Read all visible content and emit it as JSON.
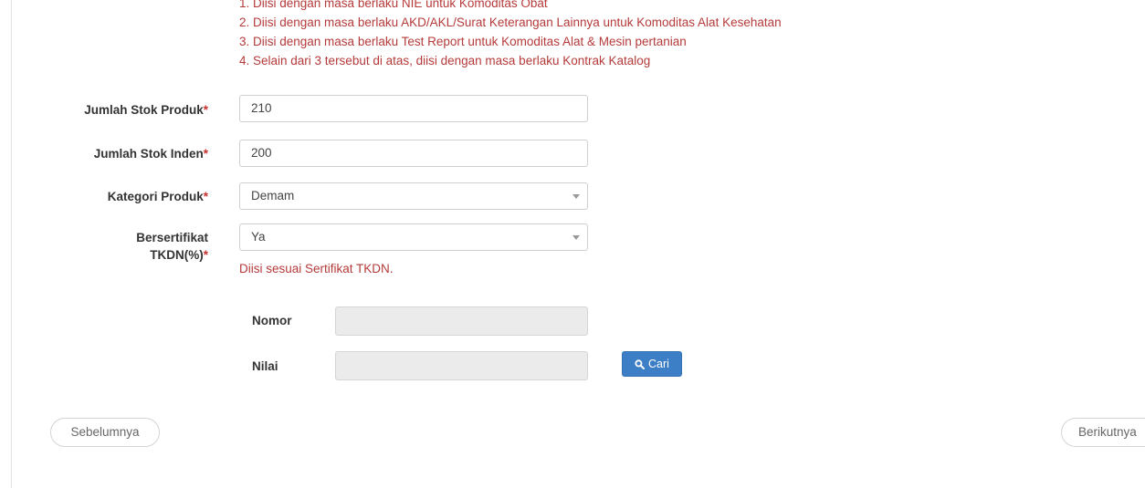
{
  "notes": [
    "1. Diisi dengan masa berlaku NIE untuk Komoditas Obat",
    "2. Diisi dengan masa berlaku AKD/AKL/Surat Keterangan Lainnya untuk Komoditas Alat Kesehatan",
    "3. Diisi dengan masa berlaku Test Report untuk Komoditas Alat & Mesin pertanian",
    "4. Selain dari 3 tersebut di atas, diisi dengan masa berlaku Kontrak Katalog"
  ],
  "required_marker": "*",
  "fields": {
    "stok_produk": {
      "label": "Jumlah Stok Produk",
      "value": "210"
    },
    "stok_inden": {
      "label": "Jumlah Stok Inden",
      "value": "200"
    },
    "kategori": {
      "label": "Kategori Produk",
      "value": "Demam"
    },
    "tkdn": {
      "label_line1": "Bersertifikat",
      "label_line2": "TKDN(%)",
      "value": "Ya",
      "help": "Diisi sesuai Sertifikat TKDN."
    }
  },
  "tkdn_lookup": {
    "nomor_label": "Nomor",
    "nomor_value": "",
    "nilai_label": "Nilai",
    "nilai_value": "",
    "search_button": "Cari",
    "search_icon": "search-icon"
  },
  "nav": {
    "prev": "Sebelumnya",
    "next": "Berikutnya"
  },
  "colors": {
    "note_text": "#b53a3a",
    "required": "#c9302c",
    "primary_button": "#3c7fc6",
    "disabled_field": "#ebebeb"
  }
}
